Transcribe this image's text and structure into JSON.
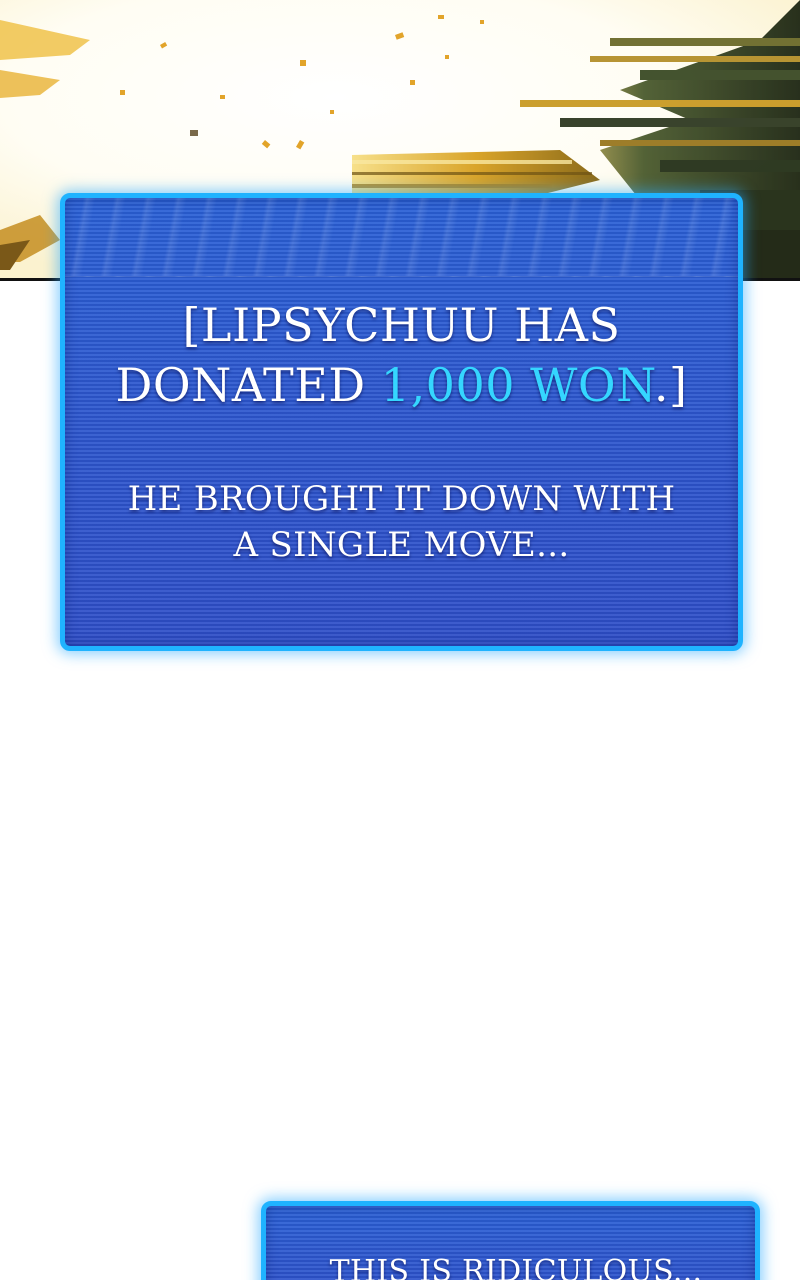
{
  "panel": {
    "illustration": "explosion-impact-flash",
    "colors": {
      "flash": "#fffdf0",
      "gold": "#e7b531",
      "dark_green": "#2f3a22"
    }
  },
  "donation_box": {
    "line1": "[LIPSYCHUU HAS",
    "line2_prefix": "DONATED ",
    "amount": "1,000 WON",
    "line2_suffix": ".]",
    "message_line1": "HE BROUGHT IT DOWN WITH",
    "message_line2": "A SINGLE MOVE..."
  },
  "chat_box_2": {
    "message": "THIS IS RIDICULOUS..."
  },
  "colors": {
    "box_fill": "#2d58cf",
    "box_border": "#1fb3ff",
    "amount_highlight": "#35d6ff",
    "text": "#ffffff"
  }
}
